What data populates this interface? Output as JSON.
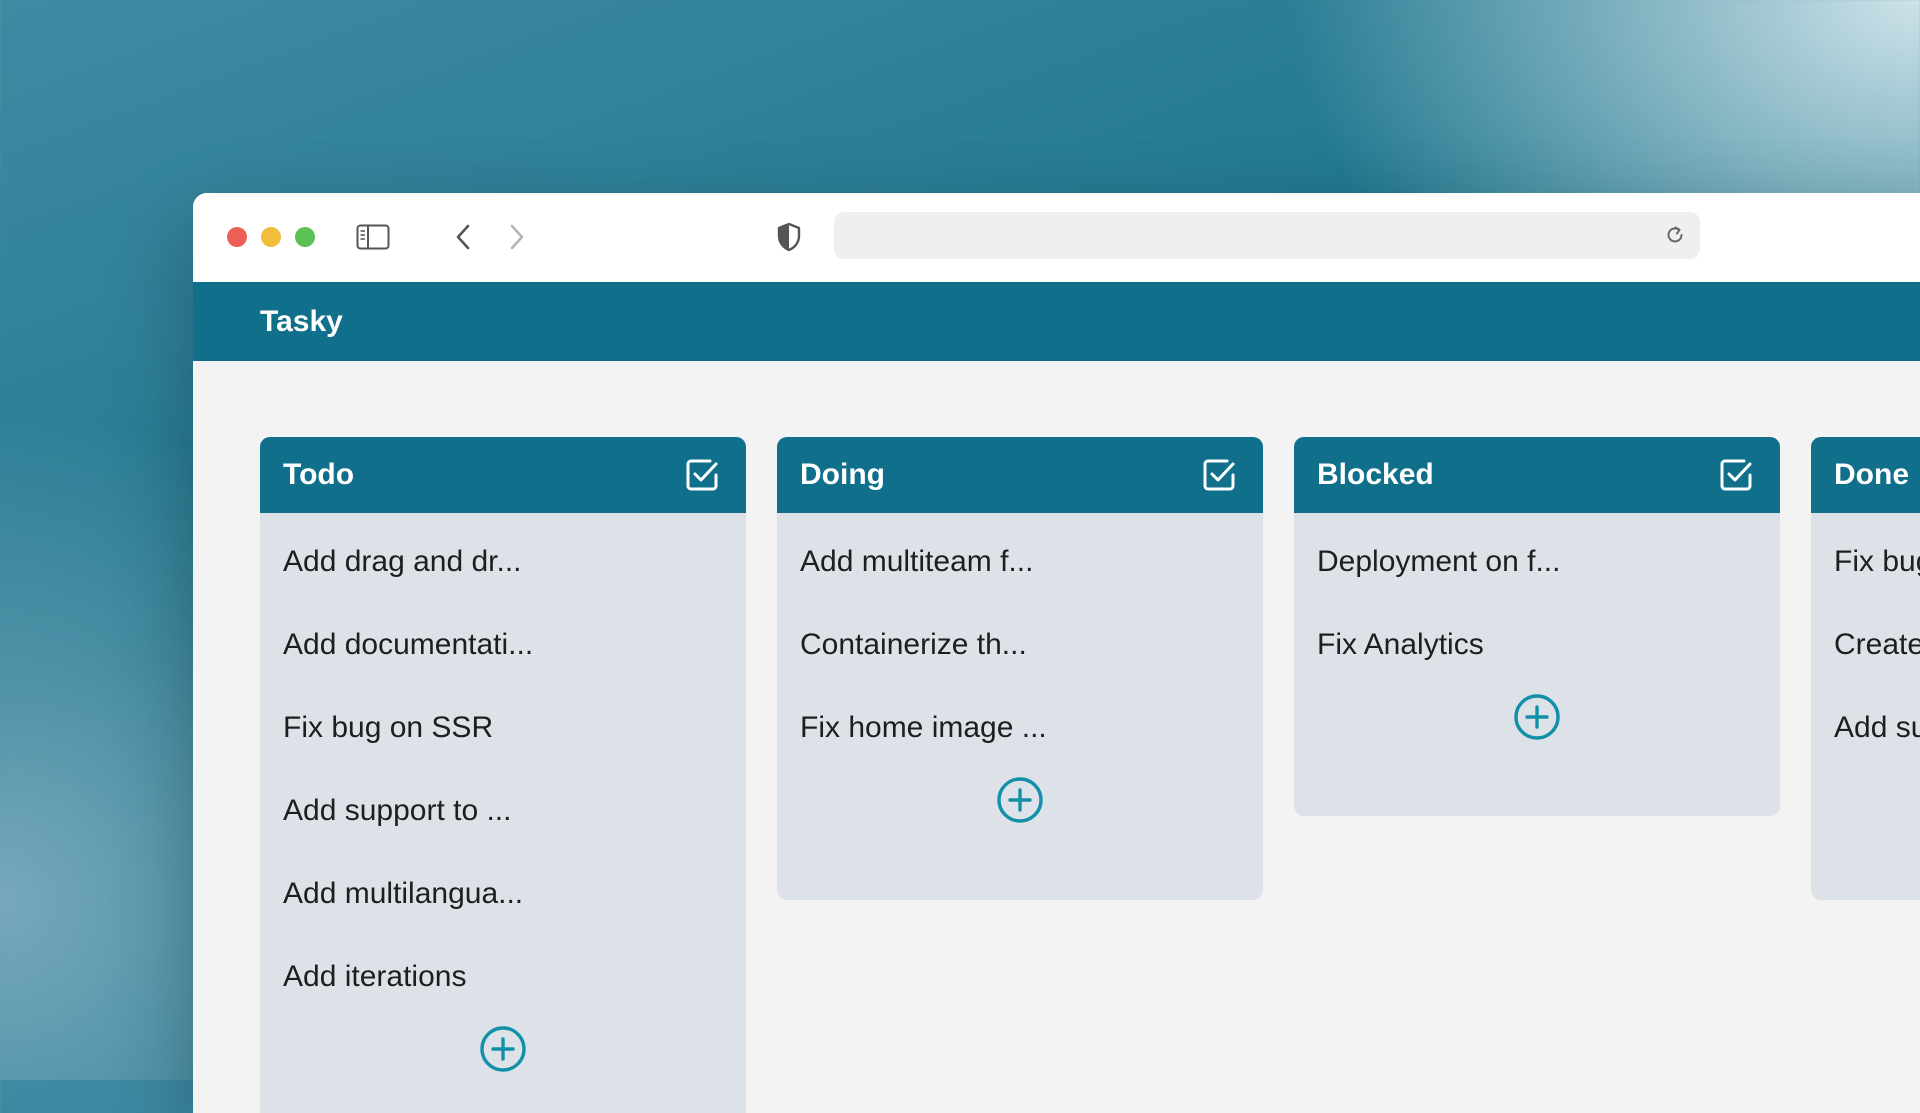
{
  "browser": {
    "url": "",
    "icons": [
      "sidebar-icon",
      "chevron-left-icon",
      "chevron-right-icon",
      "shield-icon",
      "reload-icon"
    ]
  },
  "app": {
    "title": "Tasky"
  },
  "colors": {
    "header": "#106f8a",
    "accent": "#1290a8",
    "column_bg": "#dde2e8",
    "content_bg": "#f3f3f3"
  },
  "columns": [
    {
      "title": "Todo",
      "cards": [
        "Add drag and dr...",
        "Add documentati...",
        "Fix bug on SSR",
        "Add support to ...",
        "Add multilangua...",
        "Add iterations"
      ]
    },
    {
      "title": "Doing",
      "cards": [
        "Add multiteam f...",
        "Containerize th...",
        "Fix home image ..."
      ]
    },
    {
      "title": "Blocked",
      "cards": [
        "Deployment on f...",
        "Fix Analytics"
      ]
    },
    {
      "title": "Done",
      "cards": [
        "Fix bug",
        "Create",
        "Add su"
      ]
    }
  ]
}
